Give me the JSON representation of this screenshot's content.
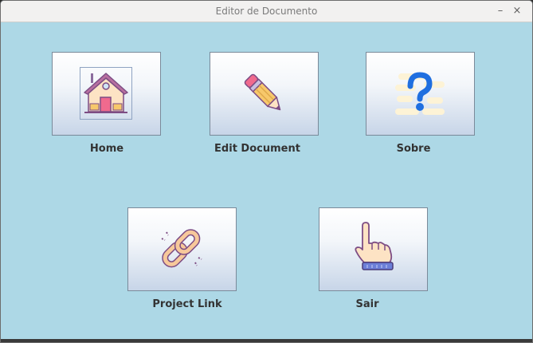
{
  "window": {
    "title": "Editor de Documento",
    "minimize_glyph": "–",
    "close_glyph": "×"
  },
  "buttons": [
    {
      "label": "Home",
      "icon": "house-icon"
    },
    {
      "label": "Edit Document",
      "icon": "pencil-icon"
    },
    {
      "label": "Sobre",
      "icon": "question-mark-icon"
    },
    {
      "label": "Project Link",
      "icon": "chain-link-icon"
    },
    {
      "label": "Sair",
      "icon": "pointing-hand-icon"
    }
  ]
}
